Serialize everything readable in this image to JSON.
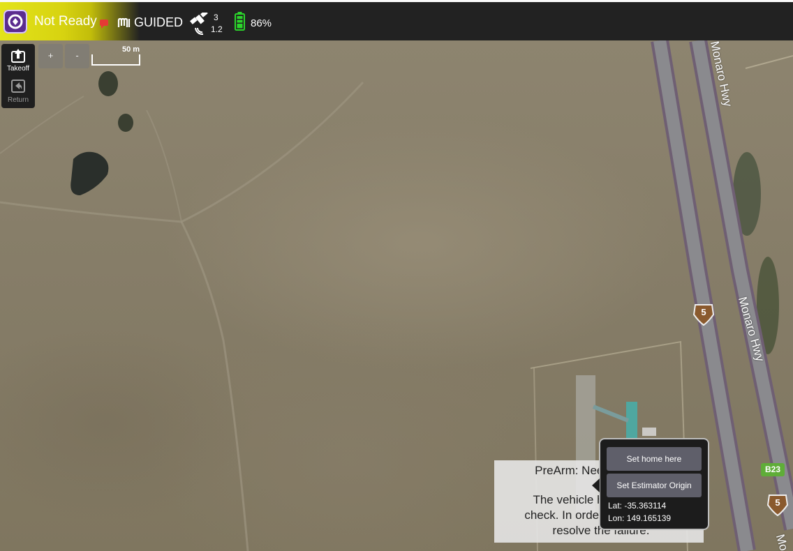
{
  "toolbar": {
    "app_icon": "qgc-logo-icon",
    "status": "Not Ready",
    "message_icon": "message-indicator-icon",
    "mode": "GUIDED",
    "gps_satellites": "3",
    "gps_hdop": "1.2",
    "battery": "86%"
  },
  "tools": {
    "takeoff": "Takeoff",
    "return": "Return"
  },
  "map": {
    "zoom_in": "+",
    "zoom_out": "-",
    "scale": "50 m",
    "road_label_top": "Monaro Hwy",
    "road_label_mid": "Monaro Hwy",
    "road_label_bottom": "Mo",
    "route_shield_1": "5",
    "route_shield_2": "5",
    "route_b23": "B23"
  },
  "prearm": {
    "line1": "PreArm: Need P",
    "line2": "The vehicle has",
    "line3": "check. In order to",
    "line4": "resolve the failure."
  },
  "popup": {
    "set_home": "Set home here",
    "set_origin": "Set Estimator Origin",
    "lat": "Lat: -35.363114",
    "lon": "Lon: 149.165139"
  },
  "colors": {
    "toolbar_bg": "#222222",
    "status_gradient": "#e3e31a",
    "battery_green": "#2bd62b",
    "popup_button": "#5f5f6a"
  }
}
